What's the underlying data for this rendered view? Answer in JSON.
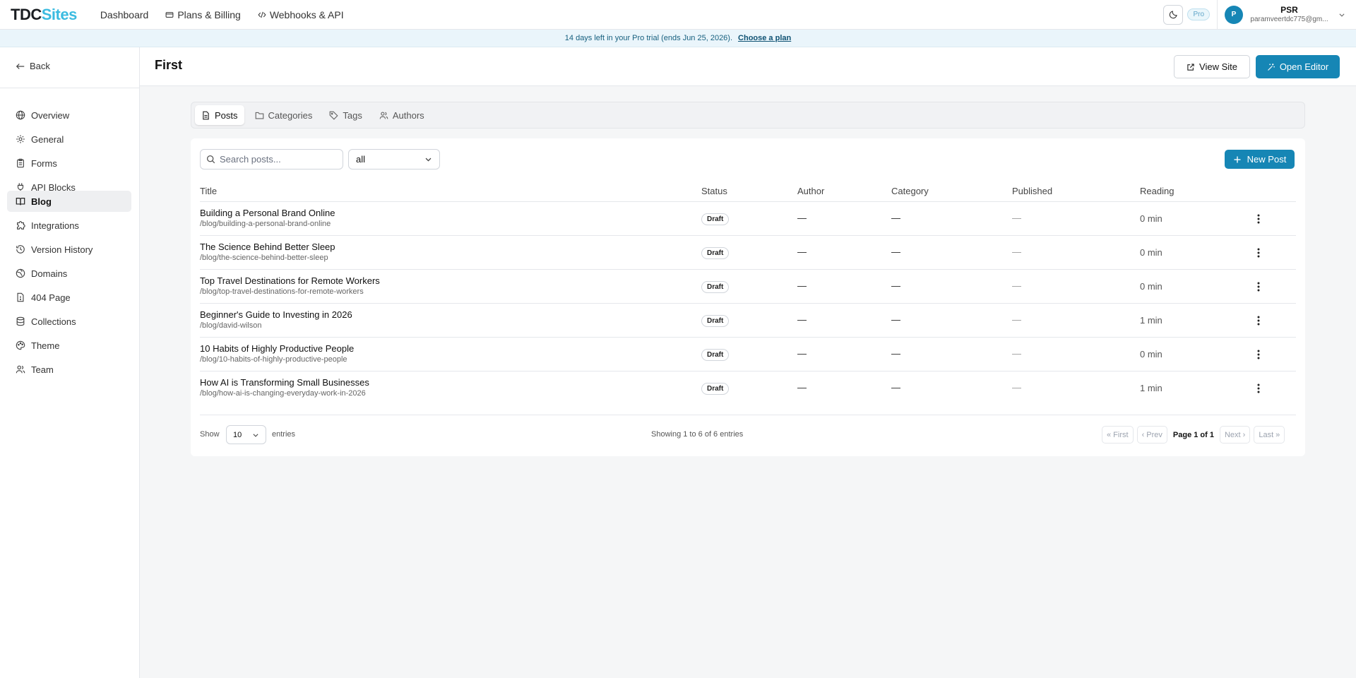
{
  "app": {
    "logo_main": "TDC",
    "logo_accent": "Sites"
  },
  "topnav": {
    "items": [
      {
        "label": "Dashboard",
        "icon": "none"
      },
      {
        "label": "Plans & Billing",
        "icon": "card-icon"
      },
      {
        "label": "Webhooks & API",
        "icon": "code-icon"
      }
    ],
    "theme_icon": "moon-icon",
    "plan_badge": "Pro",
    "user": {
      "initial": "P",
      "name": "PSR",
      "email": "paramveertdc775@gm..."
    }
  },
  "banner": {
    "text": "14 days left in your Pro trial (ends Jun 25, 2026).",
    "link": "Choose a plan"
  },
  "sidebar": {
    "back_label": "Back",
    "items": [
      {
        "label": "Overview",
        "icon": "globe-icon",
        "active": false
      },
      {
        "label": "General",
        "icon": "gear-icon",
        "active": false
      },
      {
        "label": "Forms",
        "icon": "clipboard-icon",
        "active": false
      },
      {
        "label": "API Blocks",
        "icon": "plug-icon",
        "active": false
      },
      {
        "label": "Blog",
        "icon": "book-icon",
        "active": true
      },
      {
        "label": "Integrations",
        "icon": "puzzle-icon",
        "active": false
      },
      {
        "label": "Version History",
        "icon": "history-icon",
        "active": false
      },
      {
        "label": "Domains",
        "icon": "globe-off-icon",
        "active": false
      },
      {
        "label": "404 Page",
        "icon": "file-warning-icon",
        "active": false
      },
      {
        "label": "Collections",
        "icon": "database-icon",
        "active": false
      },
      {
        "label": "Theme",
        "icon": "palette-icon",
        "active": false
      },
      {
        "label": "Team",
        "icon": "users-icon",
        "active": false
      }
    ]
  },
  "page": {
    "title": "First",
    "view_site_label": "View Site",
    "open_editor_label": "Open Editor"
  },
  "tabs": [
    {
      "label": "Posts",
      "icon": "file-text-icon",
      "active": true
    },
    {
      "label": "Categories",
      "icon": "folder-icon",
      "active": false
    },
    {
      "label": "Tags",
      "icon": "tag-icon",
      "active": false
    },
    {
      "label": "Authors",
      "icon": "users-icon",
      "active": false
    }
  ],
  "posts": {
    "search_placeholder": "Search posts...",
    "filter_value": "all",
    "new_post_label": "New Post",
    "columns": [
      "Title",
      "Status",
      "Author",
      "Category",
      "Published",
      "Reading"
    ],
    "rows": [
      {
        "title": "Building a Personal Brand Online",
        "slug": "/blog/building-a-personal-brand-online",
        "status": "Draft",
        "author": "—",
        "category": "—",
        "published": "—",
        "reading": "0 min"
      },
      {
        "title": "The Science Behind Better Sleep",
        "slug": "/blog/the-science-behind-better-sleep",
        "status": "Draft",
        "author": "—",
        "category": "—",
        "published": "—",
        "reading": "0 min"
      },
      {
        "title": "Top Travel Destinations for Remote Workers",
        "slug": "/blog/top-travel-destinations-for-remote-workers",
        "status": "Draft",
        "author": "—",
        "category": "—",
        "published": "—",
        "reading": "0 min"
      },
      {
        "title": "Beginner's Guide to Investing in 2026",
        "slug": "/blog/david-wilson",
        "status": "Draft",
        "author": "—",
        "category": "—",
        "published": "—",
        "reading": "1 min"
      },
      {
        "title": "10 Habits of Highly Productive People",
        "slug": "/blog/10-habits-of-highly-productive-people",
        "status": "Draft",
        "author": "—",
        "category": "—",
        "published": "—",
        "reading": "0 min"
      },
      {
        "title": "How AI is Transforming Small Businesses",
        "slug": "/blog/how-ai-is-changing-everyday-work-in-2026",
        "status": "Draft",
        "author": "—",
        "category": "—",
        "published": "—",
        "reading": "1 min"
      }
    ]
  },
  "pagination": {
    "show_label": "Show",
    "page_size": "10",
    "entries_label": "entries",
    "summary": "Showing 1 to 6 of 6 entries",
    "first_label": "« First",
    "prev_label": "‹ Prev",
    "current": "Page 1 of 1",
    "next_label": "Next ›",
    "last_label": "Last »"
  },
  "colors": {
    "primary": "#1686b5",
    "logo_accent": "#3bbbe0",
    "banner_bg": "#eaf5fb"
  }
}
